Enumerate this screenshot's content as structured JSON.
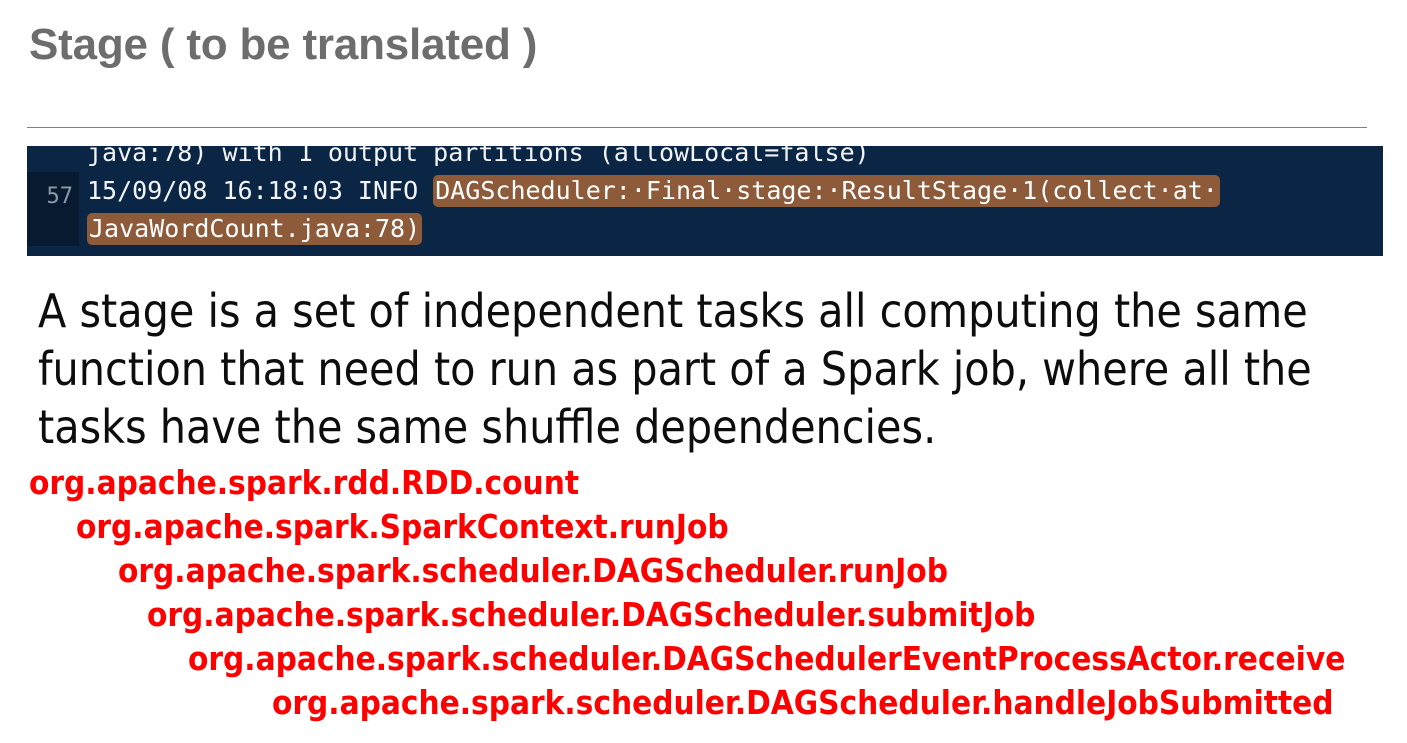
{
  "slide": {
    "title": "Stage ( to be translated )",
    "title_color": "#6d6d6d",
    "rule_color": "#808080",
    "background": "#ffffff"
  },
  "terminal": {
    "background": "#0b2545",
    "gutter_background": "#071a30",
    "text_color": "#f2f4f7",
    "selection_color": "#8d5a3a",
    "gutter_text_color": "#8d9aa8",
    "line_number": "57",
    "lines": {
      "line_1_clipped": "java:78) with 1 output partitions (allowLocal=false)",
      "line_2_prefix": "15/09/08 16:18:03 INFO ",
      "line_2_selected": "DAGScheduler:·Final·stage:·ResultStage·1(collect·at·",
      "line_3_selected": "JavaWordCount.java:78)"
    }
  },
  "body": {
    "text_color": "#0d0d0d",
    "paragraph": "A stage is a set of independent tasks all computing the same function that need to run as part of a Spark job, where all the tasks have the same shuffle dependencies.",
    "lines": [
      "A stage is a set of independent tasks all computing the same",
      "function that need to run as part of a Spark job, where all the",
      "tasks have the same shuffle dependencies."
    ]
  },
  "stack_trace": {
    "color": "#fe0000",
    "lines": [
      "org.apache.spark.rdd.RDD.count",
      "org.apache.spark.SparkContext.runJob",
      "org.apache.spark.scheduler.DAGScheduler.runJob",
      "org.apache.spark.scheduler.DAGScheduler.submitJob",
      "org.apache.spark.scheduler.DAGSchedulerEventProcessActor.receive",
      "org.apache.spark.scheduler.DAGScheduler.handleJobSubmitted"
    ]
  }
}
